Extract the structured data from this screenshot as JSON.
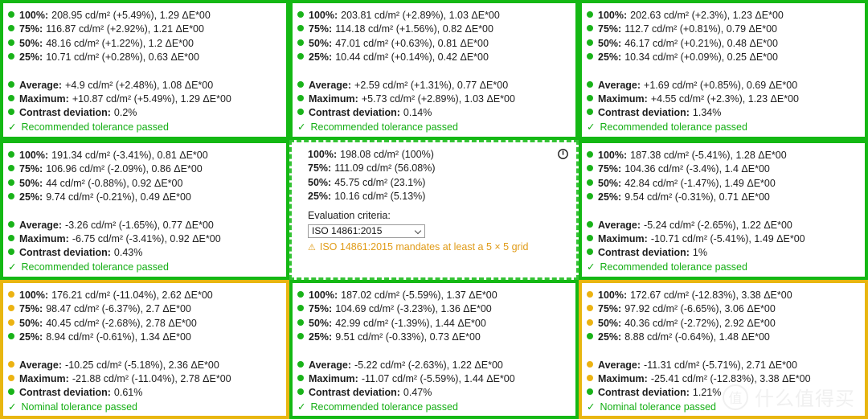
{
  "colors": {
    "pass_green": "#14b814",
    "warn_amber": "#e8b610",
    "dot_green": "#19b319",
    "dot_amber": "#ecb312",
    "status_text_green": "#13ae13",
    "warning_text": "#e09b17"
  },
  "cells": [
    {
      "id": "top-left",
      "border": "green",
      "border_style": "solid",
      "measurements": [
        {
          "dot": "g",
          "label": "100%:",
          "value": "208.95 cd/m² (+5.49%), 1.29 ΔE*00"
        },
        {
          "dot": "g",
          "label": "75%:",
          "value": "116.87 cd/m² (+2.92%), 1.21 ΔE*00"
        },
        {
          "dot": "g",
          "label": "50%:",
          "value": "48.16 cd/m² (+1.22%), 1.2 ΔE*00"
        },
        {
          "dot": "g",
          "label": "25%:",
          "value": "10.71 cd/m² (+0.28%), 0.63 ΔE*00"
        }
      ],
      "summary": [
        {
          "dot": "g",
          "label": "Average:",
          "value": "+4.9 cd/m² (+2.48%), 1.08 ΔE*00"
        },
        {
          "dot": "g",
          "label": "Maximum:",
          "value": "+10.87 cd/m² (+5.49%), 1.29 ΔE*00"
        },
        {
          "dot": "g",
          "label": "Contrast deviation:",
          "value": "0.2%"
        }
      ],
      "status": {
        "check": "✓",
        "text": "Recommended tolerance passed"
      }
    },
    {
      "id": "top-center",
      "border": "green",
      "border_style": "solid",
      "measurements": [
        {
          "dot": "g",
          "label": "100%:",
          "value": "203.81 cd/m² (+2.89%), 1.03 ΔE*00"
        },
        {
          "dot": "g",
          "label": "75%:",
          "value": "114.18 cd/m² (+1.56%), 0.82 ΔE*00"
        },
        {
          "dot": "g",
          "label": "50%:",
          "value": "47.01 cd/m² (+0.63%), 0.81 ΔE*00"
        },
        {
          "dot": "g",
          "label": "25%:",
          "value": "10.44 cd/m² (+0.14%), 0.42 ΔE*00"
        }
      ],
      "summary": [
        {
          "dot": "g",
          "label": "Average:",
          "value": "+2.59 cd/m² (+1.31%), 0.77 ΔE*00"
        },
        {
          "dot": "g",
          "label": "Maximum:",
          "value": "+5.73 cd/m² (+2.89%), 1.03 ΔE*00"
        },
        {
          "dot": "g",
          "label": "Contrast deviation:",
          "value": "0.14%"
        }
      ],
      "status": {
        "check": "✓",
        "text": "Recommended tolerance passed"
      }
    },
    {
      "id": "top-right",
      "border": "green",
      "border_style": "solid",
      "measurements": [
        {
          "dot": "g",
          "label": "100%:",
          "value": "202.63 cd/m² (+2.3%), 1.23 ΔE*00"
        },
        {
          "dot": "g",
          "label": "75%:",
          "value": "112.7 cd/m² (+0.81%), 0.79 ΔE*00"
        },
        {
          "dot": "g",
          "label": "50%:",
          "value": "46.17 cd/m² (+0.21%), 0.48 ΔE*00"
        },
        {
          "dot": "g",
          "label": "25%:",
          "value": "10.34 cd/m² (+0.09%), 0.25 ΔE*00"
        }
      ],
      "summary": [
        {
          "dot": "g",
          "label": "Average:",
          "value": "+1.69 cd/m² (+0.85%), 0.69 ΔE*00"
        },
        {
          "dot": "g",
          "label": "Maximum:",
          "value": "+4.55 cd/m² (+2.3%), 1.23 ΔE*00"
        },
        {
          "dot": "g",
          "label": "Contrast deviation:",
          "value": "1.34%"
        }
      ],
      "status": {
        "check": "✓",
        "text": "Recommended tolerance passed"
      }
    },
    {
      "id": "middle-left",
      "border": "green",
      "border_style": "solid",
      "measurements": [
        {
          "dot": "g",
          "label": "100%:",
          "value": "191.34 cd/m² (-3.41%), 0.81 ΔE*00"
        },
        {
          "dot": "g",
          "label": "75%:",
          "value": "106.96 cd/m² (-2.09%), 0.86 ΔE*00"
        },
        {
          "dot": "g",
          "label": "50%:",
          "value": "44 cd/m² (-0.88%), 0.92 ΔE*00"
        },
        {
          "dot": "g",
          "label": "25%:",
          "value": "9.74 cd/m² (-0.21%), 0.49 ΔE*00"
        }
      ],
      "summary": [
        {
          "dot": "g",
          "label": "Average:",
          "value": "-3.26 cd/m² (-1.65%), 0.77 ΔE*00"
        },
        {
          "dot": "g",
          "label": "Maximum:",
          "value": "-6.75 cd/m² (-3.41%), 0.92 ΔE*00"
        },
        {
          "dot": "g",
          "label": "Contrast deviation:",
          "value": "0.43%"
        }
      ],
      "status": {
        "check": "✓",
        "text": "Recommended tolerance passed"
      }
    },
    {
      "id": "middle-center-reference",
      "border": "green",
      "border_style": "dashed",
      "is_reference": true,
      "icon": "power-icon",
      "measurements": [
        {
          "dot": "none",
          "label": "100%:",
          "value": "198.08 cd/m² (100%)"
        },
        {
          "dot": "none",
          "label": "75%:",
          "value": "111.09 cd/m² (56.08%)"
        },
        {
          "dot": "none",
          "label": "50%:",
          "value": "45.75 cd/m² (23.1%)"
        },
        {
          "dot": "none",
          "label": "25%:",
          "value": "10.16 cd/m² (5.13%)"
        }
      ],
      "criteria_label": "Evaluation criteria:",
      "criteria_value": "ISO 14861:2015",
      "criteria_options": [
        "ISO 14861:2015"
      ],
      "warning_icon": "⚠",
      "warning_text": "ISO 14861:2015 mandates at least a 5 × 5 grid"
    },
    {
      "id": "middle-right",
      "border": "green",
      "border_style": "solid",
      "measurements": [
        {
          "dot": "g",
          "label": "100%:",
          "value": "187.38 cd/m² (-5.41%), 1.28 ΔE*00"
        },
        {
          "dot": "g",
          "label": "75%:",
          "value": "104.36 cd/m² (-3.4%), 1.4 ΔE*00"
        },
        {
          "dot": "g",
          "label": "50%:",
          "value": "42.84 cd/m² (-1.47%), 1.49 ΔE*00"
        },
        {
          "dot": "g",
          "label": "25%:",
          "value": "9.54 cd/m² (-0.31%), 0.71 ΔE*00"
        }
      ],
      "summary": [
        {
          "dot": "g",
          "label": "Average:",
          "value": "-5.24 cd/m² (-2.65%), 1.22 ΔE*00"
        },
        {
          "dot": "g",
          "label": "Maximum:",
          "value": "-10.71 cd/m² (-5.41%), 1.49 ΔE*00"
        },
        {
          "dot": "g",
          "label": "Contrast deviation:",
          "value": "1%"
        }
      ],
      "status": {
        "check": "✓",
        "text": "Recommended tolerance passed"
      }
    },
    {
      "id": "bottom-left",
      "border": "amber",
      "border_style": "solid",
      "measurements": [
        {
          "dot": "a",
          "label": "100%:",
          "value": "176.21 cd/m² (-11.04%), 2.62 ΔE*00"
        },
        {
          "dot": "a",
          "label": "75%:",
          "value": "98.47 cd/m² (-6.37%), 2.7 ΔE*00"
        },
        {
          "dot": "a",
          "label": "50%:",
          "value": "40.45 cd/m² (-2.68%), 2.78 ΔE*00"
        },
        {
          "dot": "g",
          "label": "25%:",
          "value": "8.94 cd/m² (-0.61%), 1.34 ΔE*00"
        }
      ],
      "summary": [
        {
          "dot": "a",
          "label": "Average:",
          "value": "-10.25 cd/m² (-5.18%), 2.36 ΔE*00"
        },
        {
          "dot": "a",
          "label": "Maximum:",
          "value": "-21.88 cd/m² (-11.04%), 2.78 ΔE*00"
        },
        {
          "dot": "g",
          "label": "Contrast deviation:",
          "value": "0.61%"
        }
      ],
      "status": {
        "check": "✓",
        "text": "Nominal tolerance passed"
      }
    },
    {
      "id": "bottom-center",
      "border": "green",
      "border_style": "solid",
      "measurements": [
        {
          "dot": "g",
          "label": "100%:",
          "value": "187.02 cd/m² (-5.59%), 1.37 ΔE*00"
        },
        {
          "dot": "g",
          "label": "75%:",
          "value": "104.69 cd/m² (-3.23%), 1.36 ΔE*00"
        },
        {
          "dot": "g",
          "label": "50%:",
          "value": "42.99 cd/m² (-1.39%), 1.44 ΔE*00"
        },
        {
          "dot": "g",
          "label": "25%:",
          "value": "9.51 cd/m² (-0.33%), 0.73 ΔE*00"
        }
      ],
      "summary": [
        {
          "dot": "g",
          "label": "Average:",
          "value": "-5.22 cd/m² (-2.63%), 1.22 ΔE*00"
        },
        {
          "dot": "g",
          "label": "Maximum:",
          "value": "-11.07 cd/m² (-5.59%), 1.44 ΔE*00"
        },
        {
          "dot": "g",
          "label": "Contrast deviation:",
          "value": "0.47%"
        }
      ],
      "status": {
        "check": "✓",
        "text": "Recommended tolerance passed"
      }
    },
    {
      "id": "bottom-right",
      "border": "amber",
      "border_style": "solid",
      "measurements": [
        {
          "dot": "a",
          "label": "100%:",
          "value": "172.67 cd/m² (-12.83%), 3.38 ΔE*00"
        },
        {
          "dot": "a",
          "label": "75%:",
          "value": "97.92 cd/m² (-6.65%), 3.06 ΔE*00"
        },
        {
          "dot": "a",
          "label": "50%:",
          "value": "40.36 cd/m² (-2.72%), 2.92 ΔE*00"
        },
        {
          "dot": "g",
          "label": "25%:",
          "value": "8.88 cd/m² (-0.64%), 1.48 ΔE*00"
        }
      ],
      "summary": [
        {
          "dot": "a",
          "label": "Average:",
          "value": "-11.31 cd/m² (-5.71%), 2.71 ΔE*00"
        },
        {
          "dot": "a",
          "label": "Maximum:",
          "value": "-25.41 cd/m² (-12.83%), 3.38 ΔE*00"
        },
        {
          "dot": "g",
          "label": "Contrast deviation:",
          "value": "1.21%"
        }
      ],
      "status": {
        "check": "✓",
        "text": "Nominal tolerance passed"
      }
    }
  ],
  "watermark": {
    "badge": "值",
    "text": "什么值得买"
  }
}
